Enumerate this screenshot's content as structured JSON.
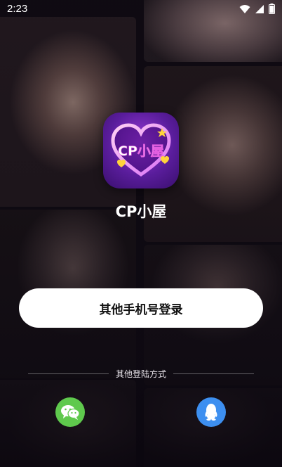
{
  "status_bar": {
    "time": "2:23",
    "icons": [
      "wifi-icon",
      "signal-icon",
      "battery-icon"
    ]
  },
  "app": {
    "name": "CP小屋",
    "icon_text": "CP小屋"
  },
  "login": {
    "phone_button_label": "其他手机号登录",
    "other_methods_label": "其他登陆方式"
  },
  "social": [
    {
      "name": "wechat-icon",
      "color": "#5fc94d"
    },
    {
      "name": "qq-icon",
      "color": "#3d8ff0"
    }
  ],
  "colors": {
    "accent_purple": "#7b2fc4",
    "wechat_green": "#5fc94d",
    "qq_blue": "#3d8ff0",
    "button_bg": "#ffffff"
  }
}
